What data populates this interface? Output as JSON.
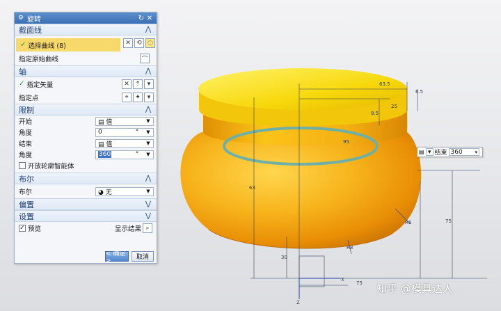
{
  "dialog": {
    "title": "旋转",
    "sections": {
      "section_curve": "截面线",
      "axis": "轴",
      "limits": "限制",
      "boolean": "布尔",
      "offset": "偏置",
      "settings": "设置"
    },
    "curve": {
      "select_curve": "选择曲线 (8)",
      "specify_origin_curve": "指定原始曲线"
    },
    "axis": {
      "specify_vector": "指定矢量",
      "specify_point": "指定点"
    },
    "limits": {
      "start_label": "开始",
      "start_type": "值",
      "start_angle_label": "角度",
      "start_angle_value": "0",
      "start_unit": "°",
      "end_label": "结束",
      "end_type": "值",
      "end_angle_label": "角度",
      "end_angle_value": "360",
      "end_unit": "°",
      "open_profile": "开放轮廓智能体"
    },
    "boolean": {
      "label": "布尔",
      "value": "无"
    },
    "settings": {
      "preview_label": "预览",
      "show_result": "显示结果"
    },
    "buttons": {
      "ok": "< 确定 >",
      "cancel": "取消"
    }
  },
  "floating_toolbar": {
    "end_label": "结束",
    "end_value": "360"
  },
  "dimensions": [
    "63.5",
    "6.5",
    "8.5",
    "25",
    "63",
    "95",
    "75",
    "R6",
    "R8",
    "30",
    "75"
  ],
  "axis_labels": {
    "x": "X",
    "z": "Z"
  },
  "watermark": "知乎 @模具达人",
  "colors": {
    "body": "#f3a20a",
    "lid": "#f7d90c",
    "ring": "#6fb0a6",
    "title_bar": "#3b6fb4"
  }
}
